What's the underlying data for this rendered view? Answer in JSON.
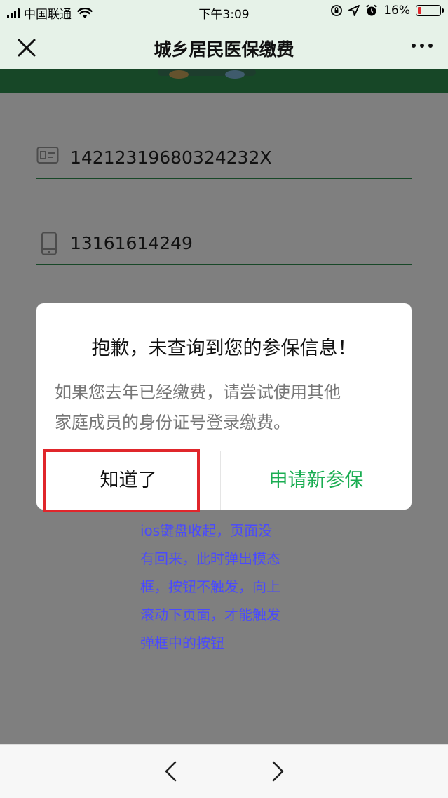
{
  "status_bar": {
    "carrier": "中国联通",
    "time": "下午3:09",
    "battery_percent": "16%",
    "battery_level": 0.16
  },
  "nav": {
    "title": "城乡居民医保缴费"
  },
  "form": {
    "id_number": "14212319680324232X",
    "phone": "13161614249"
  },
  "dialog": {
    "title": "抱歉，未查询到您的参保信息！",
    "message_line1": "如果您去年已经缴费，请尝试使用其他",
    "message_line2": "家庭成员的身份证号登录缴费。",
    "ok_label": "知道了",
    "apply_label": "申请新参保"
  },
  "note": {
    "lines": [
      "ios键盘收起，页面没",
      "有回来，此时弹出模态",
      "框，按钮不触发，向上",
      "滚动下页面，才能触发",
      "弹框中的按钮"
    ]
  },
  "colors": {
    "accent_green": "#1aad52",
    "banner_green": "#2f8f4e",
    "highlight_red": "#e0262b",
    "note_blue": "#4a4aff"
  }
}
